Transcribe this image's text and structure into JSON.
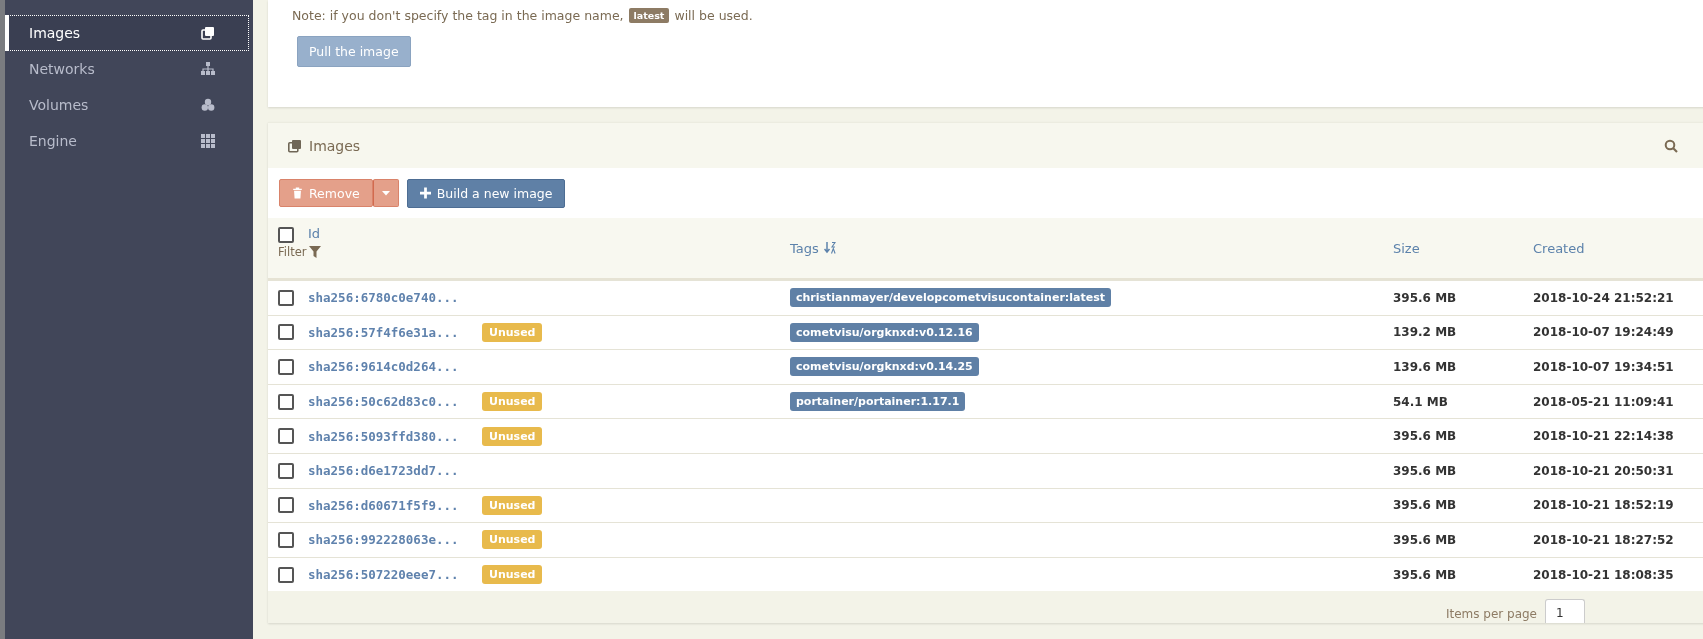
{
  "sidebar": {
    "items": [
      {
        "label": "Images",
        "selected": true
      },
      {
        "label": "Networks",
        "selected": false
      },
      {
        "label": "Volumes",
        "selected": false
      },
      {
        "label": "Engine",
        "selected": false
      }
    ]
  },
  "pull_panel": {
    "note_before": "Note: if you don't specify the tag in the image name,",
    "note_tag": "latest",
    "note_after": "will be used.",
    "button": "Pull the image"
  },
  "images_panel": {
    "title": "Images",
    "remove_button": "Remove",
    "build_button": "Build a new image",
    "select_all_checked": false,
    "columns": {
      "id": "Id",
      "filter": "Filter",
      "tags": "Tags",
      "size": "Size",
      "created": "Created"
    },
    "rows": [
      {
        "id": "sha256:6780c0e740...",
        "unused": false,
        "tags": [
          "christianmayer/developcometvisucontainer:latest"
        ],
        "size": "395.6 MB",
        "created": "2018-10-24 21:52:21",
        "checked": false
      },
      {
        "id": "sha256:57f4f6e31a...",
        "unused": true,
        "badge": "Unused",
        "tags": [
          "cometvisu/orgknxd:v0.12.16"
        ],
        "size": "139.2 MB",
        "created": "2018-10-07 19:24:49",
        "checked": false
      },
      {
        "id": "sha256:9614c0d264...",
        "unused": false,
        "tags": [
          "cometvisu/orgknxd:v0.14.25"
        ],
        "size": "139.6 MB",
        "created": "2018-10-07 19:34:51",
        "checked": false
      },
      {
        "id": "sha256:50c62d83c0...",
        "unused": true,
        "badge": "Unused",
        "tags": [
          "portainer/portainer:1.17.1"
        ],
        "size": "54.1 MB",
        "created": "2018-05-21 11:09:41",
        "checked": false
      },
      {
        "id": "sha256:5093ffd380...",
        "unused": true,
        "badge": "Unused",
        "tags": [],
        "size": "395.6 MB",
        "created": "2018-10-21 22:14:38",
        "checked": false
      },
      {
        "id": "sha256:d6e1723dd7...",
        "unused": false,
        "tags": [],
        "size": "395.6 MB",
        "created": "2018-10-21 20:50:31",
        "checked": false
      },
      {
        "id": "sha256:d60671f5f9...",
        "unused": true,
        "badge": "Unused",
        "tags": [],
        "size": "395.6 MB",
        "created": "2018-10-21 18:52:19",
        "checked": false
      },
      {
        "id": "sha256:992228063e...",
        "unused": true,
        "badge": "Unused",
        "tags": [],
        "size": "395.6 MB",
        "created": "2018-10-21 18:27:52",
        "checked": false
      },
      {
        "id": "sha256:507220eee7...",
        "unused": true,
        "badge": "Unused",
        "tags": [],
        "size": "395.6 MB",
        "created": "2018-10-21 18:08:35",
        "checked": false
      }
    ],
    "footer": {
      "items_per_page": "Items per page",
      "page_size": "1"
    }
  }
}
